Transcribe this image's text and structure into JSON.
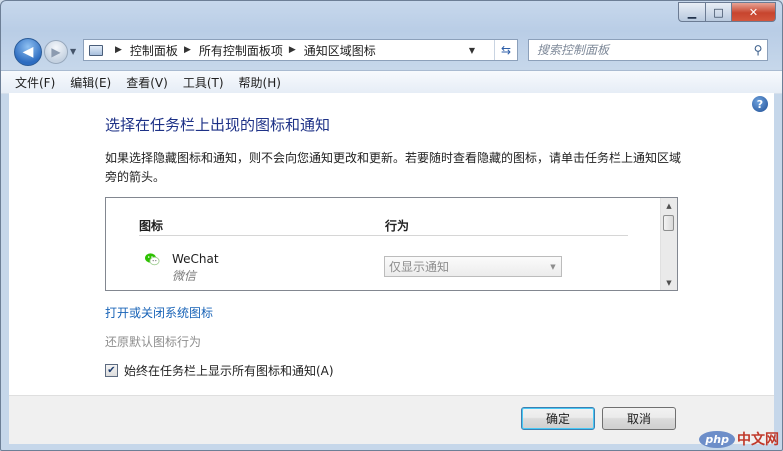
{
  "nav": {
    "address": [
      "控制面板",
      "所有控制面板项",
      "通知区域图标"
    ],
    "search_placeholder": "搜索控制面板"
  },
  "menu": [
    "文件(F)",
    "编辑(E)",
    "查看(V)",
    "工具(T)",
    "帮助(H)"
  ],
  "main": {
    "title": "选择在任务栏上出现的图标和通知",
    "description": "如果选择隐藏图标和通知，则不会向您通知更改和更新。若要随时查看隐藏的图标，请单击任务栏上通知区域旁的箭头。",
    "table": {
      "columns": [
        "图标",
        "行为"
      ],
      "rows": [
        {
          "name": "WeChat",
          "subtitle": "微信",
          "behavior": "仅显示通知"
        }
      ]
    },
    "link_system_icons": "打开或关闭系统图标",
    "link_restore": "还原默认图标行为",
    "checkbox": {
      "label": "始终在任务栏上显示所有图标和通知(A)",
      "checked": true
    }
  },
  "buttons": {
    "ok": "确定",
    "cancel": "取消"
  },
  "watermark": {
    "php": "php",
    "text": "中文网"
  },
  "colors": {
    "title": "#1e3287",
    "link": "#1863b7",
    "disabled_link": "#8e8e8e",
    "wechat_green": "#2dc100"
  }
}
